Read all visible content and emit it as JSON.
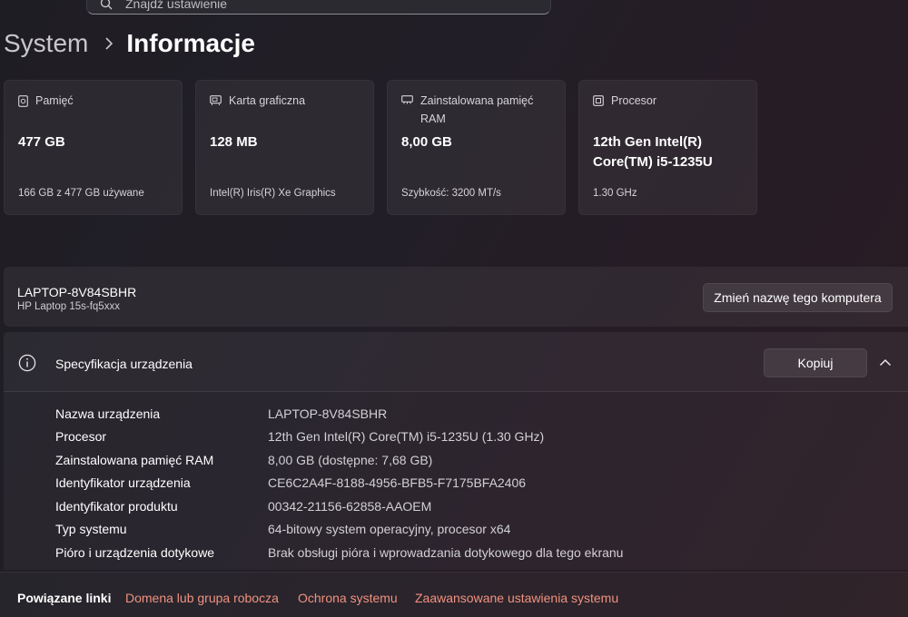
{
  "search": {
    "placeholder": "Znajdź ustawienie"
  },
  "breadcrumb": {
    "parent": "System",
    "current": "Informacje"
  },
  "cards": [
    {
      "label": "Pamięć",
      "value": "477 GB",
      "sub": "166 GB z 477 GB używane",
      "icon": "storage-icon"
    },
    {
      "label": "Karta graficzna",
      "value": "128 MB",
      "sub": "Intel(R) Iris(R) Xe Graphics",
      "icon": "graphics-card-icon"
    },
    {
      "label": "Zainstalowana pamięć RAM",
      "value": "8,00 GB",
      "sub": "Szybkość: 3200 MT/s",
      "icon": "ram-icon"
    },
    {
      "label": "Procesor",
      "value": "12th Gen Intel(R) Core(TM) i5-1235U",
      "sub": "1.30 GHz",
      "icon": "processor-icon"
    }
  ],
  "device": {
    "name": "LAPTOP-8V84SBHR",
    "model": "HP Laptop 15s-fq5xxx",
    "rename_label": "Zmień nazwę tego komputera"
  },
  "specs": {
    "title": "Specyfikacja urządzenia",
    "copy_label": "Kopiuj",
    "rows": [
      {
        "key": "Nazwa urządzenia",
        "value": "LAPTOP-8V84SBHR"
      },
      {
        "key": "Procesor",
        "value": "12th Gen Intel(R) Core(TM) i5-1235U (1.30 GHz)"
      },
      {
        "key": "Zainstalowana pamięć RAM",
        "value": "8,00 GB (dostępne: 7,68 GB)"
      },
      {
        "key": "Identyfikator urządzenia",
        "value": "CE6C2A4F-8188-4956-BFB5-F7175BFA2406"
      },
      {
        "key": "Identyfikator produktu",
        "value": "00342-21156-62858-AAOEM"
      },
      {
        "key": "Typ systemu",
        "value": "64-bitowy system operacyjny, procesor x64"
      },
      {
        "key": "Pióro i urządzenia dotykowe",
        "value": "Brak obsługi pióra i wprowadzania dotykowego dla tego ekranu"
      }
    ]
  },
  "related": {
    "title": "Powiązane linki",
    "links": [
      "Domena lub grupa robocza",
      "Ochrona systemu",
      "Zaawansowane ustawienia systemu"
    ]
  },
  "colors": {
    "link": "#f0927f",
    "text": "#ffffff",
    "muted": "#d2d0d5"
  }
}
